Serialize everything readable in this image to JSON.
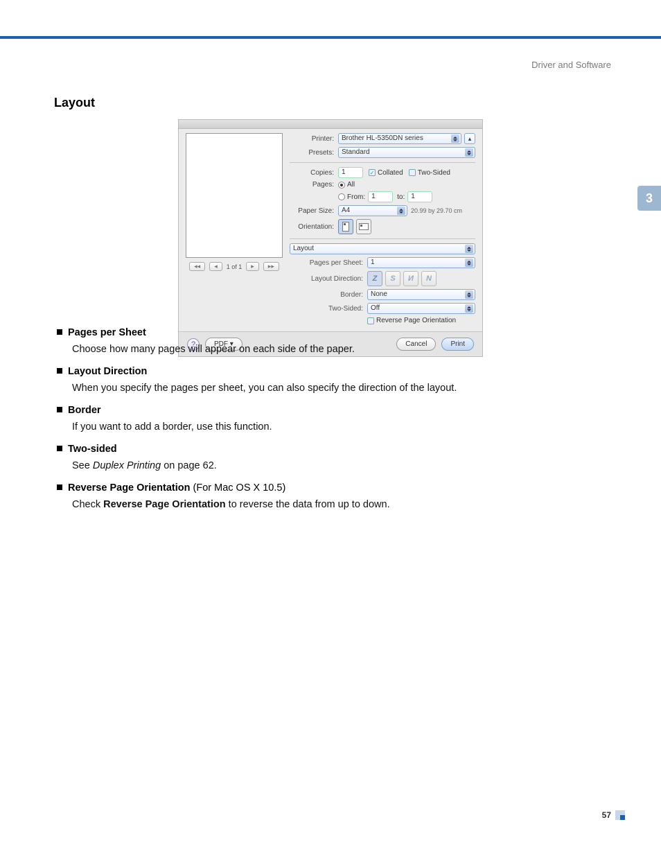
{
  "header": {
    "breadcrumb": "Driver and Software"
  },
  "section": {
    "title": "Layout",
    "sidebar_chapter": "3"
  },
  "dialog": {
    "pager": {
      "status": "1 of 1"
    },
    "labels": {
      "printer": "Printer:",
      "presets": "Presets:",
      "copies": "Copies:",
      "pages": "Pages:",
      "from": "From:",
      "to": "to:",
      "paper_size": "Paper Size:",
      "orientation": "Orientation:",
      "pages_per_sheet": "Pages per Sheet:",
      "layout_direction": "Layout Direction:",
      "border": "Border:",
      "two_sided": "Two-Sided:"
    },
    "values": {
      "printer": "Brother HL-5350DN series",
      "presets": "Standard",
      "copies": "1",
      "collated_label": "Collated",
      "two_sided_label": "Two-Sided",
      "pages_all": "All",
      "from": "1",
      "to": "1",
      "paper_size": "A4",
      "paper_dims": "20.99 by 29.70 cm",
      "panel": "Layout",
      "pages_per_sheet": "1",
      "border": "None",
      "two_sided": "Off",
      "reverse_label": "Reverse Page Orientation"
    },
    "footer": {
      "pdf": "PDF ▾",
      "cancel": "Cancel",
      "print": "Print",
      "help": "?"
    }
  },
  "items": [
    {
      "title": "Pages per Sheet",
      "desc": "Choose how many pages will appear on each side of the paper."
    },
    {
      "title": "Layout Direction",
      "desc": "When you specify the pages per sheet, you can also specify the direction of the layout."
    },
    {
      "title": "Border",
      "desc": "If you want to add a border, use this function."
    },
    {
      "title": "Two-sided",
      "desc_prefix": "See ",
      "desc_link": "Duplex Printing",
      "desc_suffix": " on page 62."
    },
    {
      "title": "Reverse Page Orientation",
      "title_suffix": " (For Mac OS X 10.5)",
      "desc_prefix": "Check ",
      "desc_bold": "Reverse Page Orientation",
      "desc_suffix2": " to reverse the data from up to down."
    }
  ],
  "footer": {
    "page_number": "57"
  }
}
